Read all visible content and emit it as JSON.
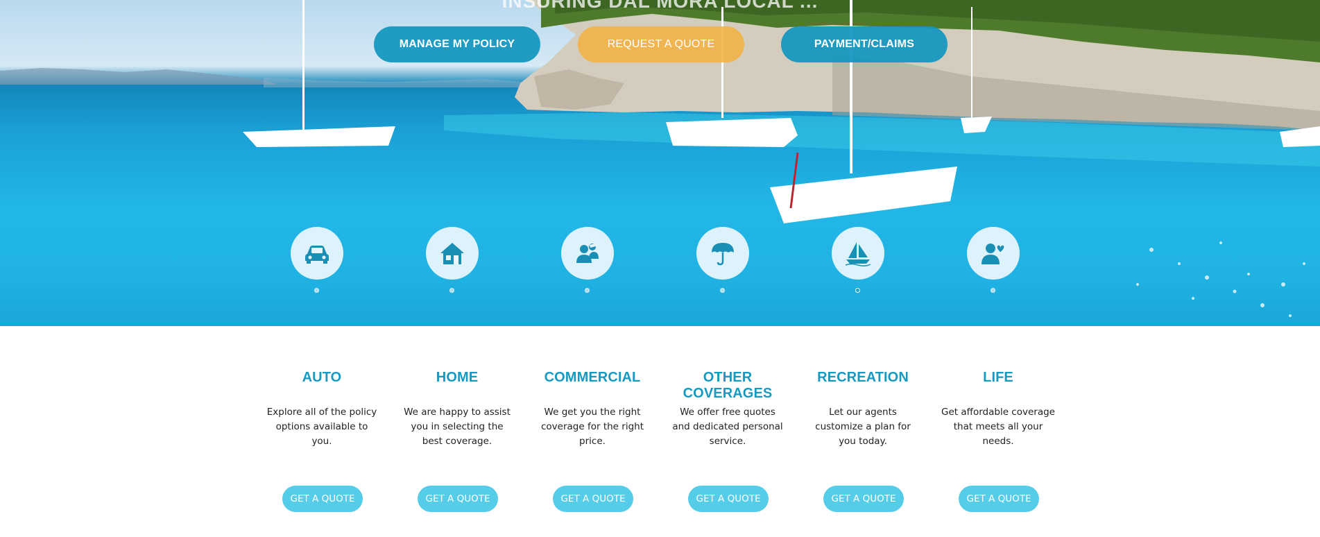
{
  "hero": {
    "heading": "INSURING DAL MORA LOCAL ...",
    "cta_buttons": [
      {
        "label": "MANAGE MY POLICY",
        "style": "blue"
      },
      {
        "label": "REQUEST A QUOTE",
        "style": "orange"
      },
      {
        "label": "PAYMENT/CLAIMS",
        "style": "blue"
      }
    ],
    "category_icons": [
      {
        "icon": "car-icon"
      },
      {
        "icon": "house-icon"
      },
      {
        "icon": "commercial-people-icon"
      },
      {
        "icon": "umbrella-icon"
      },
      {
        "icon": "sailboat-icon",
        "active": true
      },
      {
        "icon": "person-heart-icon"
      }
    ]
  },
  "cards": [
    {
      "title": "AUTO",
      "text": "Explore all of the policy options available to you.",
      "button": "GET A QUOTE"
    },
    {
      "title": "HOME",
      "text": "We are happy to assist you in selecting the best coverage.",
      "button": "GET A QUOTE"
    },
    {
      "title": "COMMERCIAL",
      "text": "We get you the right coverage for the right price.",
      "button": "GET A QUOTE"
    },
    {
      "title": "OTHER COVERAGES",
      "text": "We offer free quotes and dedicated personal service.",
      "button": "GET A QUOTE"
    },
    {
      "title": "RECREATION",
      "text": "Let our agents customize a plan for you today.",
      "button": "GET A QUOTE"
    },
    {
      "title": "LIFE",
      "text": "Get affordable coverage that meets all your needs.",
      "button": "GET A QUOTE"
    }
  ],
  "colors": {
    "brand_blue": "#1899c0",
    "cta_blue": "#1296be",
    "cta_orange": "#f2b241",
    "quote_button": "#55cde8"
  }
}
